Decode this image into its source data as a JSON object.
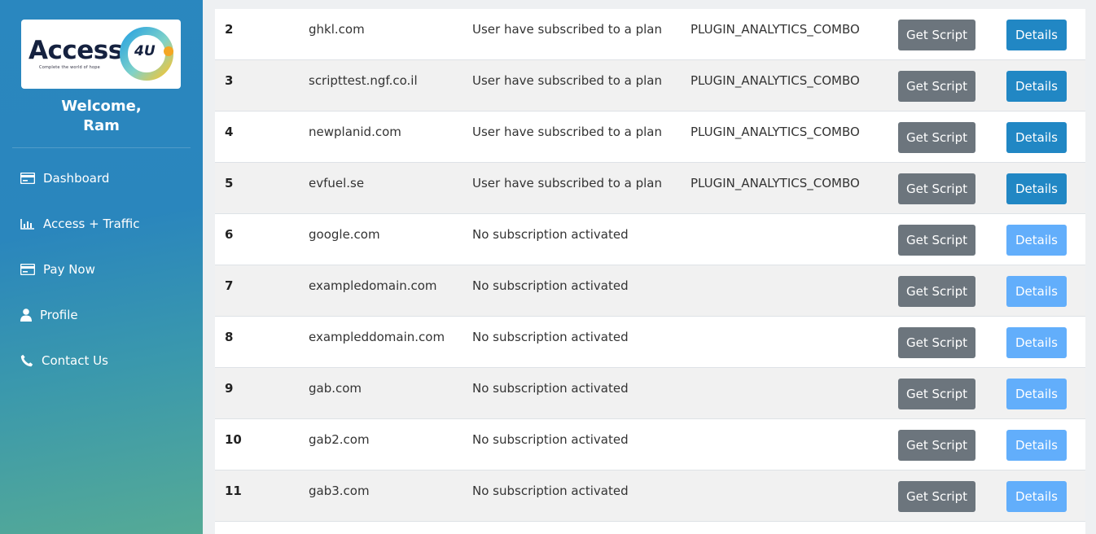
{
  "brand": {
    "logo_text": "Access",
    "logo_badge": "4U",
    "logo_tagline": "Complete the world of hope"
  },
  "user": {
    "welcome_line1": "Welcome,",
    "welcome_line2": "Ram"
  },
  "sidebar": {
    "items": [
      {
        "label": "Dashboard",
        "icon": "card-icon"
      },
      {
        "label": "Access + Traffic",
        "icon": "bar-chart-icon"
      },
      {
        "label": "Pay Now",
        "icon": "card-icon"
      },
      {
        "label": "Profile",
        "icon": "user-icon"
      },
      {
        "label": "Contact Us",
        "icon": "phone-icon"
      }
    ]
  },
  "colors": {
    "script_button": "#6c757d",
    "details_active": "#2187c4",
    "details_disabled": "#62aefb"
  },
  "table": {
    "get_script_label": "Get Script",
    "details_label": "Details",
    "rows": [
      {
        "num": "2",
        "domain": "ghkl.com",
        "status": "User have subscribed to a plan",
        "plan": "PLUGIN_ANALYTICS_COMBO",
        "details_enabled": true
      },
      {
        "num": "3",
        "domain": "scripttest.ngf.co.il",
        "status": "User have subscribed to a plan",
        "plan": "PLUGIN_ANALYTICS_COMBO",
        "details_enabled": true
      },
      {
        "num": "4",
        "domain": "newplanid.com",
        "status": "User have subscribed to a plan",
        "plan": "PLUGIN_ANALYTICS_COMBO",
        "details_enabled": true
      },
      {
        "num": "5",
        "domain": "evfuel.se",
        "status": "User have subscribed to a plan",
        "plan": "PLUGIN_ANALYTICS_COMBO",
        "details_enabled": true
      },
      {
        "num": "6",
        "domain": "google.com",
        "status": "No subscription activated",
        "plan": "",
        "details_enabled": false
      },
      {
        "num": "7",
        "domain": "exampledomain.com",
        "status": "No subscription activated",
        "plan": "",
        "details_enabled": false
      },
      {
        "num": "8",
        "domain": "exampleddomain.com",
        "status": "No subscription activated",
        "plan": "",
        "details_enabled": false
      },
      {
        "num": "9",
        "domain": "gab.com",
        "status": "No subscription activated",
        "plan": "",
        "details_enabled": false
      },
      {
        "num": "10",
        "domain": "gab2.com",
        "status": "No subscription activated",
        "plan": "",
        "details_enabled": false
      },
      {
        "num": "11",
        "domain": "gab3.com",
        "status": "No subscription activated",
        "plan": "",
        "details_enabled": false
      }
    ]
  }
}
